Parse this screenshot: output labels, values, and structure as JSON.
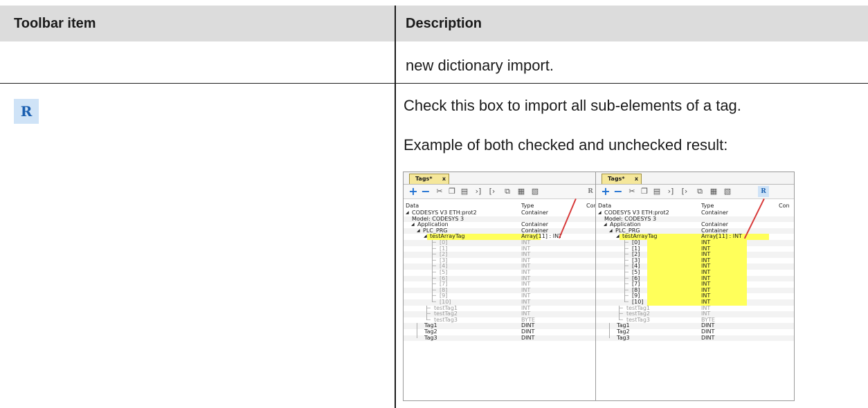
{
  "header": {
    "col1": "Toolbar item",
    "col2": "Description"
  },
  "row1": {
    "text": "new dictionary import."
  },
  "row2": {
    "icon_letter": "R",
    "line1": "Check this box to import all sub-elements of a tag.",
    "line2": "Example of both checked and unchecked result:"
  },
  "panel": {
    "tab_label": "Tags*",
    "tab_close": "x",
    "toolbar_icons": [
      "plus-icon",
      "minus-icon",
      "cut-icon",
      "copy-icon",
      "paste-icon",
      "import-icon",
      "export-icon",
      "tag-icon",
      "dictionary-icon",
      "dictionary-all-icon",
      "r-icon"
    ],
    "col_data": "Data",
    "col_type": "Type",
    "col_con": "Con",
    "rows": [
      {
        "name": "CODESYS V3 ETH:prot2",
        "type": "Container"
      },
      {
        "name": "Model: CODESYS 3",
        "type": ""
      },
      {
        "name": "Application",
        "type": "Container"
      },
      {
        "name": "PLC_PRG",
        "type": "Container"
      },
      {
        "name": "testArrayTag",
        "type": "Array[11] : INT"
      },
      {
        "name": "[0]",
        "type": "INT"
      },
      {
        "name": "[1]",
        "type": "INT"
      },
      {
        "name": "[2]",
        "type": "INT"
      },
      {
        "name": "[3]",
        "type": "INT"
      },
      {
        "name": "[4]",
        "type": "INT"
      },
      {
        "name": "[5]",
        "type": "INT"
      },
      {
        "name": "[6]",
        "type": "INT"
      },
      {
        "name": "[7]",
        "type": "INT"
      },
      {
        "name": "[8]",
        "type": "INT"
      },
      {
        "name": "[9]",
        "type": "INT"
      },
      {
        "name": "[10]",
        "type": "INT"
      },
      {
        "name": "testTag1",
        "type": "INT"
      },
      {
        "name": "testTag2",
        "type": "INT"
      },
      {
        "name": "testTag3",
        "type": "BYTE"
      },
      {
        "name": "Tag1",
        "type": "DINT"
      },
      {
        "name": "Tag2",
        "type": "DINT"
      },
      {
        "name": "Tag3",
        "type": "DINT"
      }
    ]
  },
  "colors": {
    "header_bg": "#dcdcdc",
    "highlight": "#ffff5a",
    "arrow": "#d83a3a",
    "r_icon_bg": "#cfe3f7"
  }
}
